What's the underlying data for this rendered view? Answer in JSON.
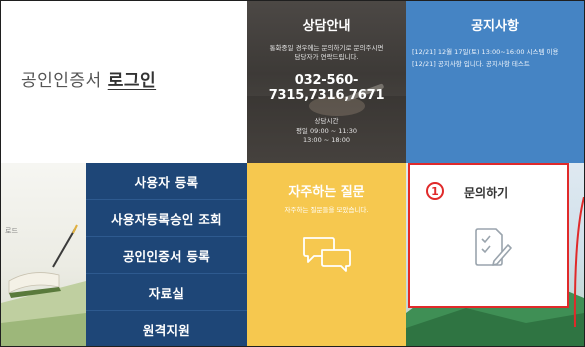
{
  "login": {
    "prefix": "공인인증서",
    "link": "로그인"
  },
  "consult": {
    "title": "상담안내",
    "desc_line1": "통화중일 경우에는 문의하기로 문의주시면",
    "desc_line2": "담당자가 연락드립니다.",
    "phone": "032-560-7315,7316,7671",
    "hours_label": "상담시간",
    "hours_line1": "평일 09:00 ~ 11:30",
    "hours_line2": "13:00 ~ 18:00"
  },
  "notice": {
    "title": "공지사항",
    "items": [
      "[12/21] 12월 17일(토) 13:00~16:00 시스템 이용",
      "[12/21] 공지사항 입니다. 공지사항 테스트"
    ]
  },
  "menu": {
    "items": [
      "사용자 등록",
      "사용자등록승인 조회",
      "공인인증서 등록",
      "자료실",
      "원격지원"
    ]
  },
  "faq": {
    "title": "자주하는 질문",
    "desc": "자주하는 질문들을 모았습니다."
  },
  "inquiry": {
    "number": "1",
    "title": "문의하기"
  },
  "scene": {
    "label": "로드"
  },
  "colors": {
    "menu_blue": "#1e4677",
    "notice_blue": "#4584c4",
    "faq_yellow": "#f6c84f",
    "highlight_red": "#e02a2a"
  }
}
